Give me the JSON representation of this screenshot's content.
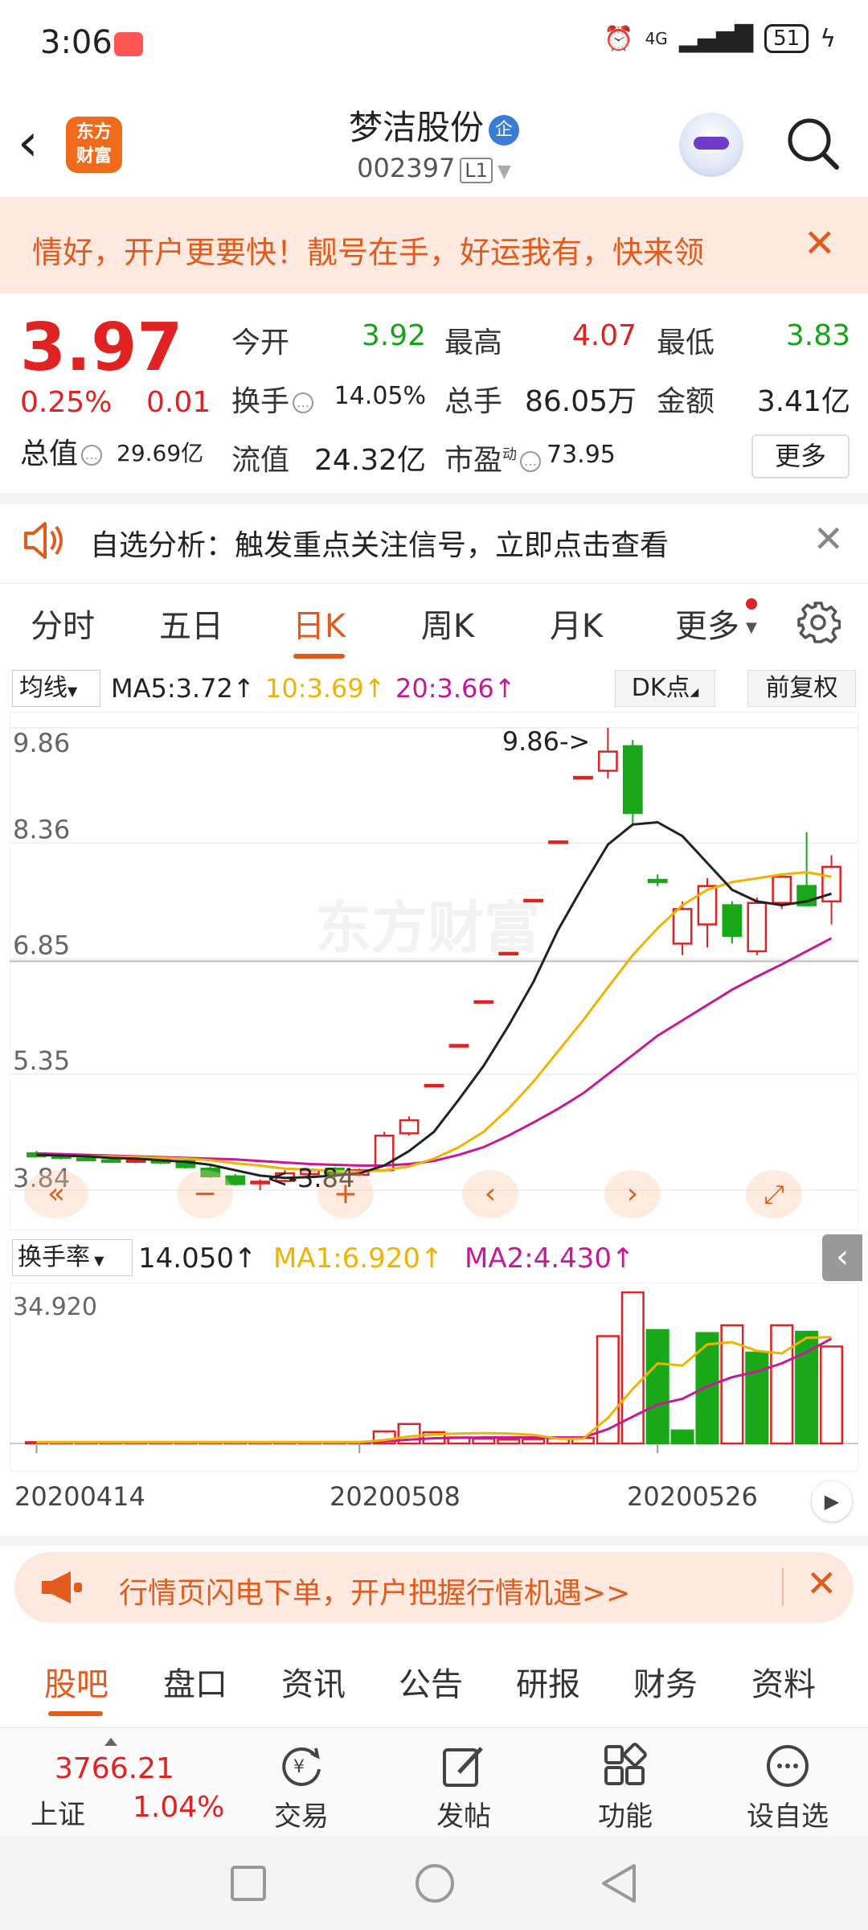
{
  "status_bar": {
    "time": "3:06",
    "network": "4G",
    "battery": "51"
  },
  "header": {
    "logo_text_1": "东方",
    "logo_text_2": "财富",
    "stock_name": "梦洁股份",
    "verified_badge": "企",
    "stock_code": "002397",
    "level": "L1"
  },
  "promo": {
    "text": "情好，开户更要快！靓号在手，好运我有，快来领"
  },
  "quote": {
    "price": "3.97",
    "change_pct": "0.25%",
    "change_abs": "0.01",
    "open_label": "今开",
    "open": "3.92",
    "high_label": "最高",
    "high": "4.07",
    "low_label": "最低",
    "low": "3.83",
    "turnover_label": "换手",
    "turnover": "14.05%",
    "volume_label": "总手",
    "volume": "86.05万",
    "amount_label": "金额",
    "amount": "3.41亿",
    "mcap_label": "总值",
    "mcap": "29.69亿",
    "float_label": "流值",
    "float_cap": "24.32亿",
    "pe_label": "市盈",
    "pe_sup": "动",
    "pe": "73.95",
    "more_label": "更多"
  },
  "notice": {
    "text": "自选分析：触发重点关注信号，立即点击查看"
  },
  "period_tabs": [
    "分时",
    "五日",
    "日K",
    "周K",
    "月K",
    "更多"
  ],
  "ma_legend": {
    "selector": "均线",
    "ma5": "MA5:3.72↑",
    "ma10": "10:3.69↑",
    "ma20": "20:3.66↑",
    "dk_label": "DK点",
    "adjust_label": "前复权",
    "colors": {
      "ma5": "#222222",
      "ma10": "#f0b400",
      "ma20": "#c8189a"
    }
  },
  "chart_data": [
    {
      "type": "candlestick",
      "y_ticks": [
        "9.86",
        "8.36",
        "6.85",
        "5.35",
        "3.84"
      ],
      "ylim": [
        3.84,
        9.86
      ],
      "annotations": {
        "max_label": "9.86->",
        "min_label": "<-3.84"
      },
      "watermark": "东方财富",
      "candles": [
        {
          "o": 4.32,
          "h": 4.35,
          "l": 4.27,
          "c": 4.28,
          "up": false
        },
        {
          "o": 4.28,
          "h": 4.3,
          "l": 4.24,
          "c": 4.26,
          "up": false
        },
        {
          "o": 4.25,
          "h": 4.27,
          "l": 4.22,
          "c": 4.24,
          "up": false
        },
        {
          "o": 4.23,
          "h": 4.25,
          "l": 4.2,
          "c": 4.22,
          "up": false
        },
        {
          "o": 4.22,
          "h": 4.25,
          "l": 4.19,
          "c": 4.23,
          "up": true
        },
        {
          "o": 4.23,
          "h": 4.25,
          "l": 4.18,
          "c": 4.2,
          "up": false
        },
        {
          "o": 4.22,
          "h": 4.24,
          "l": 4.12,
          "c": 4.14,
          "up": false
        },
        {
          "o": 4.12,
          "h": 4.15,
          "l": 4.0,
          "c": 4.02,
          "up": false
        },
        {
          "o": 4.02,
          "h": 4.05,
          "l": 3.9,
          "c": 3.92,
          "up": false
        },
        {
          "o": 3.93,
          "h": 3.98,
          "l": 3.84,
          "c": 3.95,
          "up": true
        },
        {
          "o": 3.96,
          "h": 4.1,
          "l": 3.94,
          "c": 4.06,
          "up": true
        },
        {
          "o": 4.05,
          "h": 4.12,
          "l": 4.0,
          "c": 4.1,
          "up": true
        },
        {
          "o": 4.12,
          "h": 4.14,
          "l": 4.0,
          "c": 4.04,
          "up": false
        },
        {
          "o": 4.04,
          "h": 4.12,
          "l": 4.02,
          "c": 4.1,
          "up": true
        },
        {
          "o": 4.1,
          "h": 4.6,
          "l": 4.08,
          "c": 4.55,
          "up": true
        },
        {
          "o": 4.58,
          "h": 4.8,
          "l": 4.55,
          "c": 4.75,
          "up": true
        },
        {
          "o": 5.21,
          "h": 5.21,
          "l": 5.21,
          "c": 5.21,
          "up": true
        },
        {
          "o": 5.73,
          "h": 5.73,
          "l": 5.73,
          "c": 5.73,
          "up": true
        },
        {
          "o": 6.3,
          "h": 6.3,
          "l": 6.3,
          "c": 6.3,
          "up": true
        },
        {
          "o": 6.93,
          "h": 6.93,
          "l": 6.93,
          "c": 6.93,
          "up": true
        },
        {
          "o": 7.62,
          "h": 7.62,
          "l": 7.62,
          "c": 7.62,
          "up": true
        },
        {
          "o": 8.38,
          "h": 8.38,
          "l": 8.38,
          "c": 8.38,
          "up": true
        },
        {
          "o": 9.22,
          "h": 9.22,
          "l": 9.22,
          "c": 9.22,
          "up": true
        },
        {
          "o": 9.3,
          "h": 9.86,
          "l": 9.2,
          "c": 9.55,
          "up": true
        },
        {
          "o": 9.62,
          "h": 9.7,
          "l": 8.6,
          "c": 8.75,
          "up": false
        },
        {
          "o": 7.85,
          "h": 7.95,
          "l": 7.8,
          "c": 7.88,
          "up": false
        },
        {
          "o": 7.05,
          "h": 7.6,
          "l": 6.9,
          "c": 7.5,
          "up": true
        },
        {
          "o": 7.3,
          "h": 7.9,
          "l": 7.0,
          "c": 7.8,
          "up": true
        },
        {
          "o": 7.55,
          "h": 7.6,
          "l": 7.05,
          "c": 7.15,
          "up": false
        },
        {
          "o": 6.95,
          "h": 7.65,
          "l": 6.9,
          "c": 7.58,
          "up": true
        },
        {
          "o": 7.58,
          "h": 7.95,
          "l": 7.5,
          "c": 7.92,
          "up": true
        },
        {
          "o": 7.8,
          "h": 8.5,
          "l": 7.55,
          "c": 7.55,
          "up": false
        },
        {
          "o": 7.6,
          "h": 8.2,
          "l": 7.3,
          "c": 8.05,
          "up": true
        }
      ],
      "ma5": [
        4.3,
        4.29,
        4.28,
        4.26,
        4.25,
        4.23,
        4.21,
        4.17,
        4.1,
        4.03,
        4.0,
        4.01,
        4.03,
        4.06,
        4.16,
        4.35,
        4.6,
        5.02,
        5.46,
        5.98,
        6.55,
        7.23,
        7.8,
        8.34,
        8.6,
        8.63,
        8.45,
        8.1,
        7.75,
        7.6,
        7.55,
        7.6,
        7.7
      ],
      "ma10": [
        4.3,
        4.29,
        4.28,
        4.28,
        4.27,
        4.26,
        4.25,
        4.23,
        4.19,
        4.16,
        4.12,
        4.11,
        4.09,
        4.08,
        4.1,
        4.15,
        4.25,
        4.4,
        4.6,
        4.9,
        5.25,
        5.65,
        6.05,
        6.48,
        6.9,
        7.25,
        7.55,
        7.75,
        7.85,
        7.9,
        7.95,
        7.98,
        7.92
      ],
      "ma20": [
        4.32,
        4.31,
        4.3,
        4.29,
        4.28,
        4.27,
        4.26,
        4.25,
        4.24,
        4.22,
        4.2,
        4.18,
        4.17,
        4.16,
        4.16,
        4.18,
        4.22,
        4.3,
        4.4,
        4.55,
        4.72,
        4.9,
        5.1,
        5.35,
        5.6,
        5.85,
        6.05,
        6.25,
        6.45,
        6.62,
        6.78,
        6.95,
        7.12
      ]
    },
    {
      "type": "bar",
      "title": "换手率",
      "ylim": [
        0,
        34.92
      ],
      "y_max_label": "34.920",
      "x_tick_labels": [
        "20200414",
        "20200508",
        "20200526"
      ],
      "values": [
        0.3,
        0.3,
        0.3,
        0.3,
        0.3,
        0.3,
        0.3,
        0.3,
        0.3,
        0.3,
        0.3,
        0.3,
        0.3,
        0.3,
        2.8,
        4.5,
        2.6,
        1.4,
        1.1,
        0.9,
        1.0,
        1.2,
        1.3,
        24.8,
        34.9,
        26.2,
        3.0,
        25.5,
        27.3,
        21.0,
        27.3,
        25.8,
        22.4
      ],
      "up": [
        true,
        true,
        true,
        true,
        true,
        true,
        true,
        true,
        true,
        true,
        true,
        true,
        true,
        true,
        true,
        true,
        true,
        true,
        true,
        true,
        true,
        true,
        true,
        true,
        true,
        false,
        false,
        false,
        true,
        false,
        true,
        false,
        true
      ],
      "ma1": [
        0.3,
        0.3,
        0.3,
        0.3,
        0.3,
        0.3,
        0.3,
        0.3,
        0.3,
        0.3,
        0.3,
        0.3,
        0.3,
        0.3,
        0.8,
        1.6,
        2.1,
        2.3,
        2.4,
        2.3,
        2.0,
        1.1,
        1.1,
        5.9,
        12.6,
        18.5,
        18.0,
        22.9,
        23.4,
        21.4,
        20.8,
        24.4,
        24.6
      ],
      "ma2": [
        0.3,
        0.3,
        0.3,
        0.3,
        0.3,
        0.3,
        0.3,
        0.3,
        0.3,
        0.3,
        0.3,
        0.3,
        0.3,
        0.3,
        0.5,
        0.9,
        1.2,
        1.3,
        1.4,
        1.4,
        1.4,
        1.4,
        1.4,
        3.3,
        6.2,
        9.0,
        10.3,
        13.2,
        15.3,
        16.6,
        18.5,
        21.1,
        24.2
      ]
    }
  ],
  "turnover_legend": {
    "selector": "换手率",
    "value": "14.050↑",
    "ma1": "MA1:6.920↑",
    "ma2": "MA2:4.430↑"
  },
  "account_banner": {
    "text": "行情页闪电下单，开户把握行情机遇>>"
  },
  "content_tabs": [
    "股吧",
    "盘口",
    "资讯",
    "公告",
    "研报",
    "财务",
    "资料"
  ],
  "bottom_bar": {
    "index_value": "3766.21",
    "index_name": "上证",
    "index_pct": "1.04%",
    "actions": [
      "交易",
      "发帖",
      "功能",
      "设自选"
    ]
  }
}
